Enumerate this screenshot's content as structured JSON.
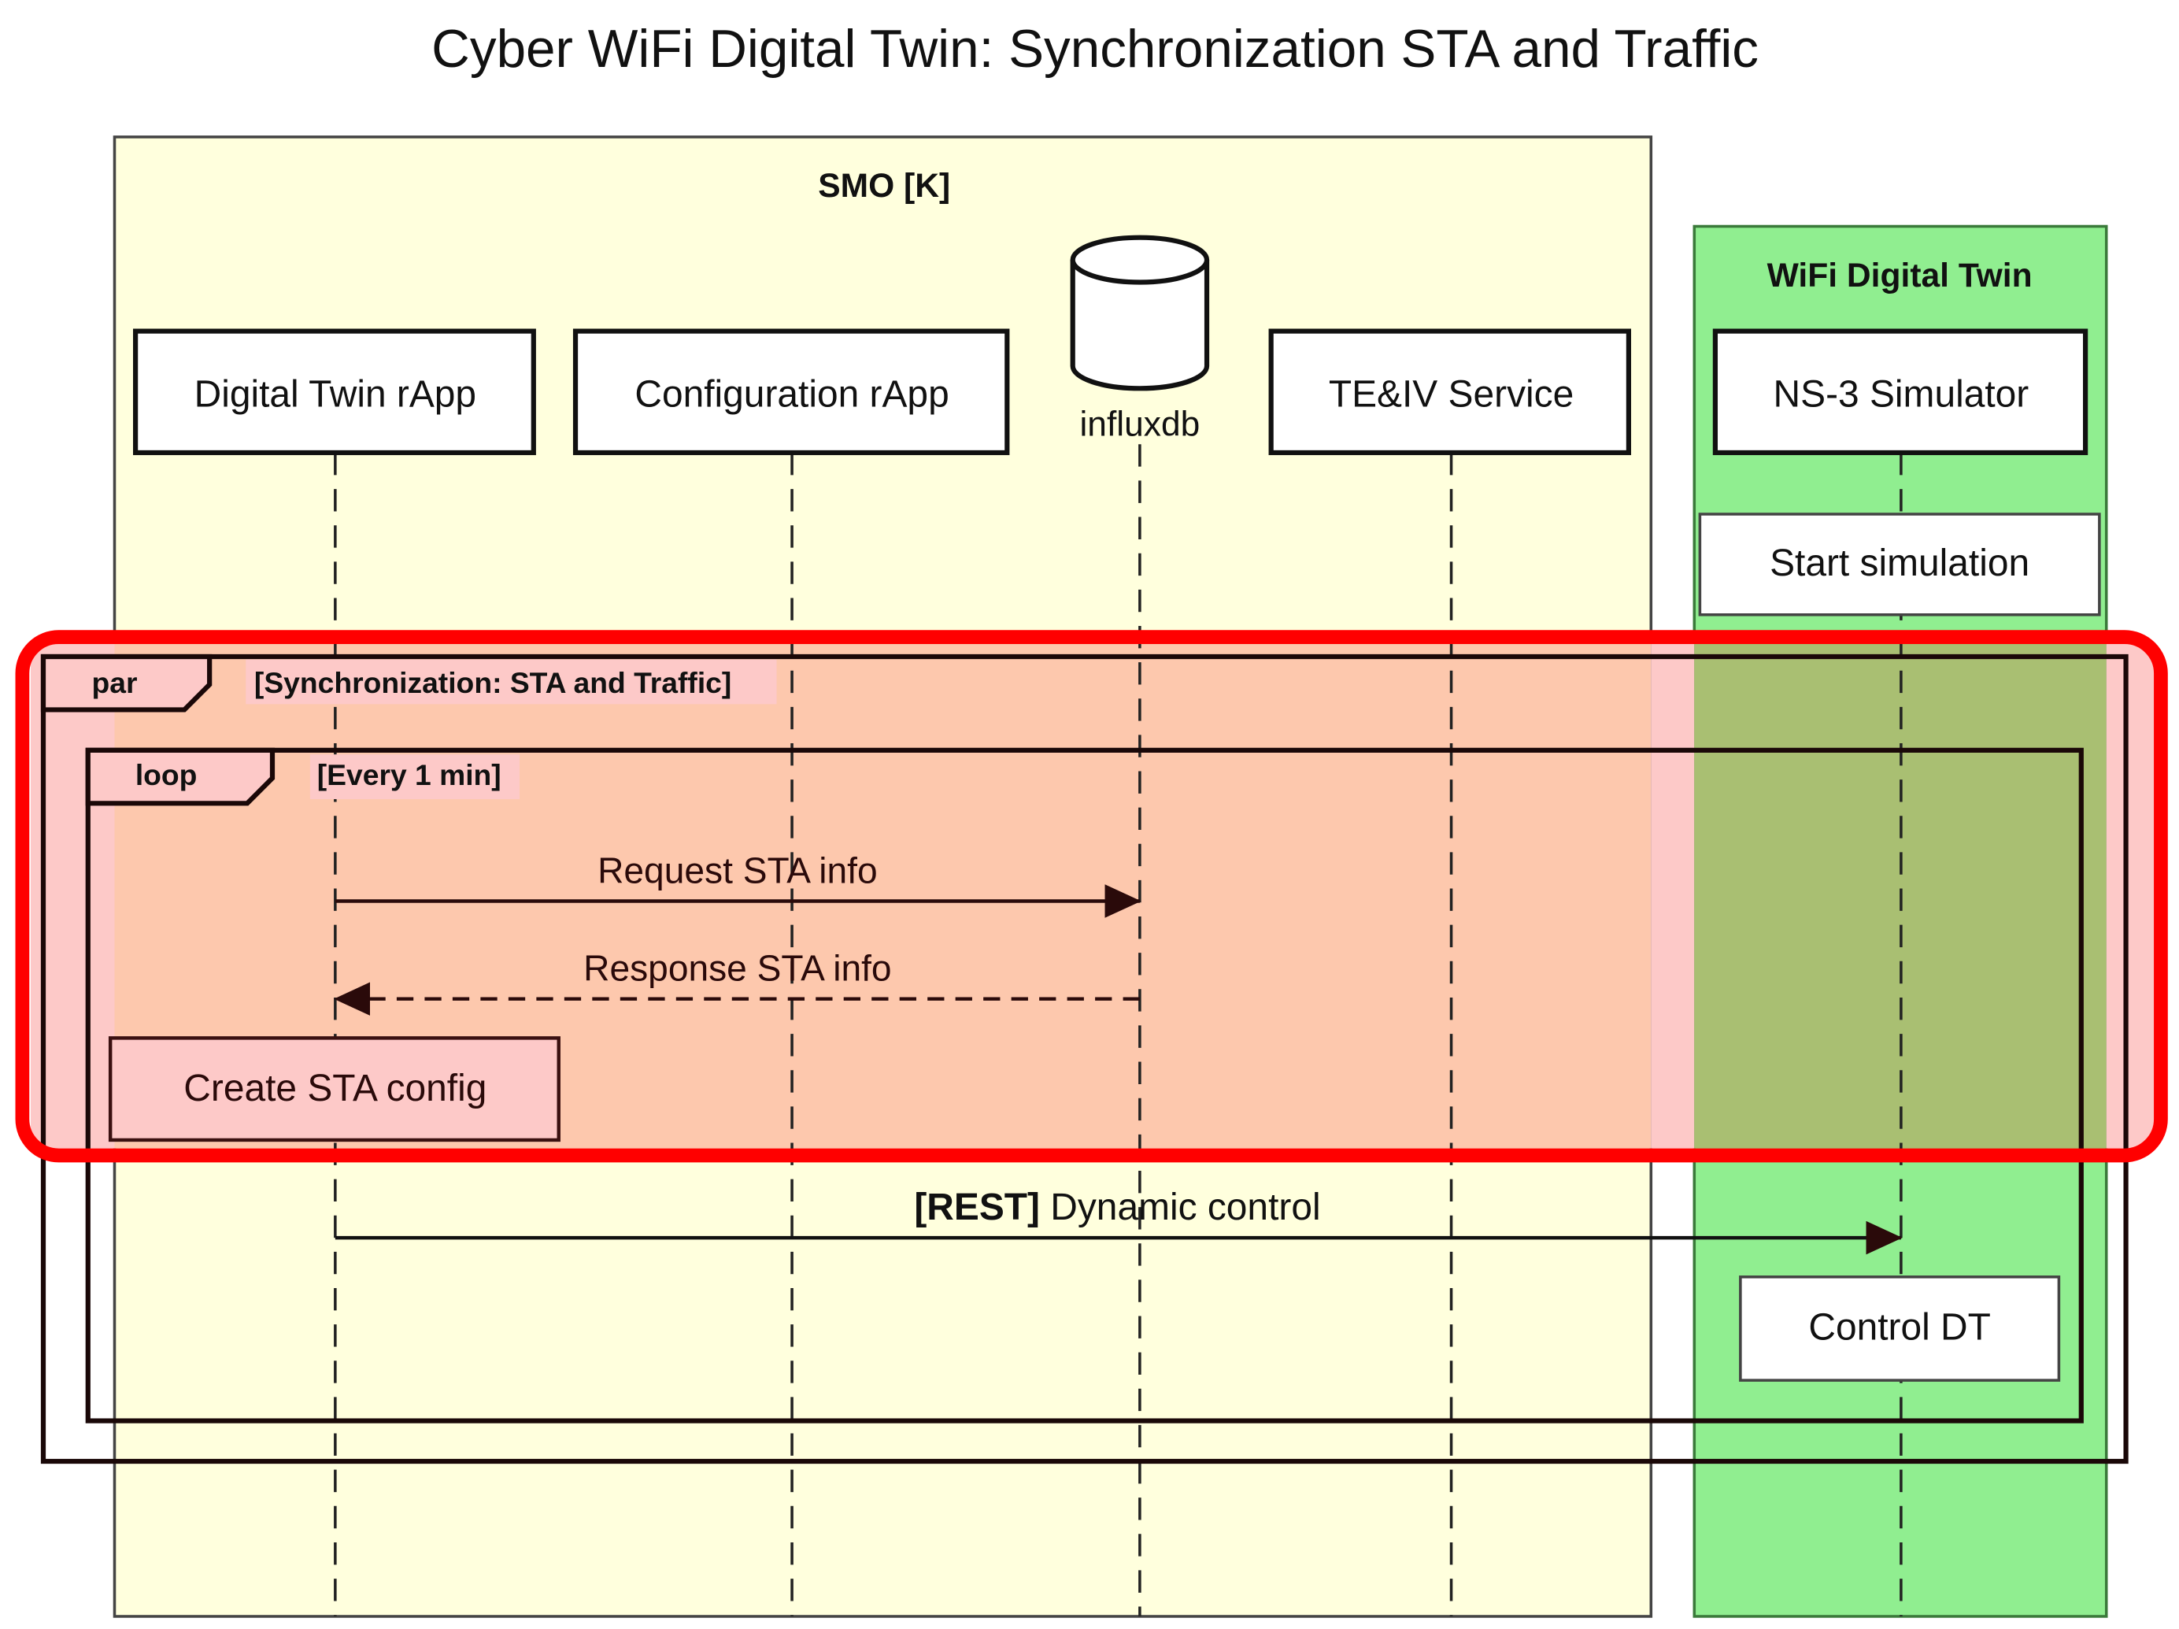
{
  "title": "Cyber WiFi Digital Twin: Synchronization STA and Traffic",
  "groups": {
    "smo": {
      "label": "SMO [K]",
      "color": "#ffffdd"
    },
    "wifi_dt": {
      "label": "WiFi Digital Twin",
      "color": "#90ee90"
    }
  },
  "participants": {
    "dt_rapp": "Digital Twin rApp",
    "config_rapp": "Configuration rApp",
    "influxdb": "influxdb",
    "teiv": "TE&IV Service",
    "ns3": "NS-3 Simulator"
  },
  "notes": {
    "start_sim": "Start simulation",
    "create_sta": "Create STA config",
    "control_dt": "Control DT"
  },
  "fragments": {
    "par": {
      "keyword": "par",
      "condition": "[Synchronization: STA and Traffic]"
    },
    "loop": {
      "keyword": "loop",
      "condition": "[Every 1 min]"
    }
  },
  "messages": {
    "request": "Request STA info",
    "response": "Response STA info",
    "rest_prefix": "[REST]",
    "rest_text": " Dynamic control"
  },
  "highlight": {
    "color": "#ff0000"
  }
}
